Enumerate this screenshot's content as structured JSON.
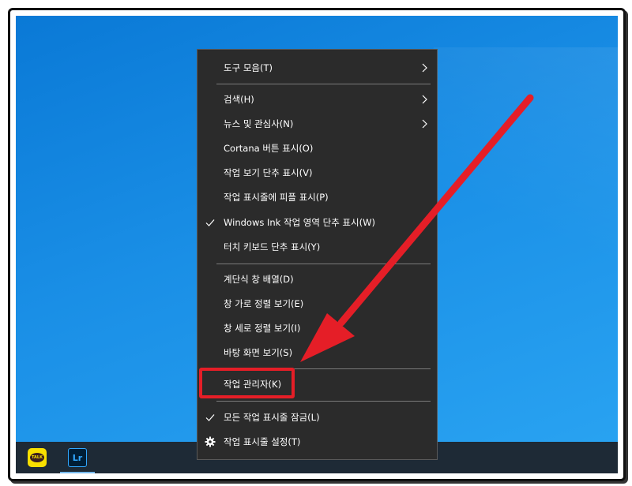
{
  "taskbar": {
    "apps": [
      {
        "name": "KakaoTalk",
        "icon": "kakaotalk-icon",
        "badge": "TALK",
        "color": "#f9e000"
      },
      {
        "name": "Lightroom",
        "icon": "lightroom-icon",
        "badge": "Lr",
        "color": "#31a8ff"
      }
    ]
  },
  "menu": {
    "items": [
      {
        "label": "도구 모음(T)",
        "submenu": true
      },
      {
        "label": "검색(H)",
        "submenu": true
      },
      {
        "label": "뉴스 및 관심사(N)",
        "submenu": true
      },
      {
        "label": "Cortana 버튼 표시(O)"
      },
      {
        "label": "작업 보기 단추 표시(V)"
      },
      {
        "label": "작업 표시줄에 피플 표시(P)"
      },
      {
        "label": "Windows Ink 작업 영역 단추 표시(W)",
        "checked": true
      },
      {
        "label": "터치 키보드 단추 표시(Y)"
      },
      {
        "label": "계단식 창 배열(D)"
      },
      {
        "label": "창 가로 정렬 보기(E)"
      },
      {
        "label": "창 세로 정렬 보기(I)"
      },
      {
        "label": "바탕 화면 보기(S)"
      },
      {
        "label": "작업 관리자(K)",
        "highlighted": true
      },
      {
        "label": "모든 작업 표시줄 잠금(L)",
        "checked": true
      },
      {
        "label": "작업 표시줄 설정(T)",
        "icon": "gear-icon"
      }
    ]
  },
  "annotation": {
    "highlight_color": "#e51e27",
    "arrow_color": "#e51e27"
  }
}
